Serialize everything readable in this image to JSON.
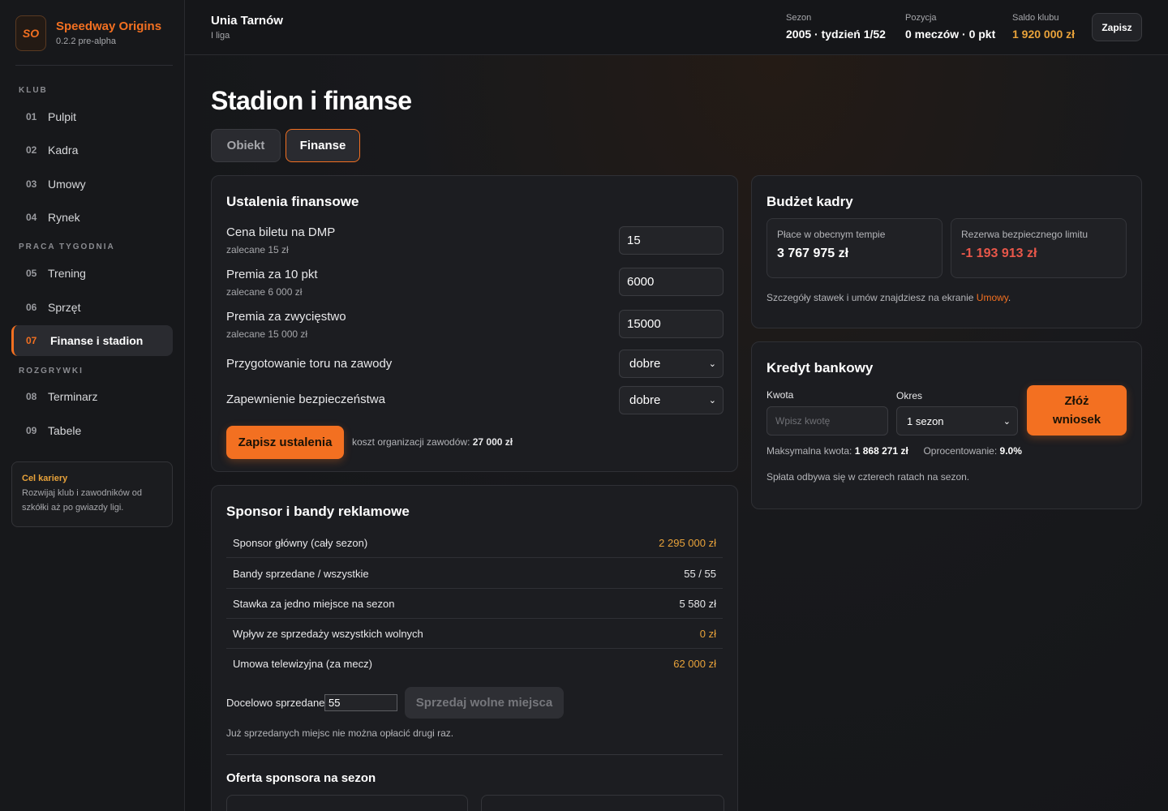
{
  "brand": {
    "logo": "SO",
    "name": "Speedway Origins",
    "version": "0.2.2 pre-alpha"
  },
  "nav": {
    "sections": [
      "KLUB",
      "PRACA TYGODNIA",
      "ROZGRYWKI"
    ],
    "items": [
      {
        "num": "01",
        "label": "Pulpit"
      },
      {
        "num": "02",
        "label": "Kadra"
      },
      {
        "num": "03",
        "label": "Umowy"
      },
      {
        "num": "04",
        "label": "Rynek"
      },
      {
        "num": "05",
        "label": "Trening"
      },
      {
        "num": "06",
        "label": "Sprzęt"
      },
      {
        "num": "07",
        "label": "Finanse i stadion"
      },
      {
        "num": "08",
        "label": "Terminarz"
      },
      {
        "num": "09",
        "label": "Tabele"
      }
    ]
  },
  "career": {
    "title": "Cel kariery",
    "text": "Rozwijaj klub i zawodników od szkółki aż po gwiazdy ligi."
  },
  "top": {
    "team": "Unia Tarnów",
    "league": "I liga",
    "season_label": "Sezon",
    "season_value": "2005 · tydzień 1/52",
    "position_label": "Pozycja",
    "position_value": "0 meczów · 0 pkt",
    "balance_label": "Saldo klubu",
    "balance_value": "1 920 000 zł",
    "save": "Zapisz"
  },
  "page": {
    "title": "Stadion i finanse",
    "tabs": [
      "Obiekt",
      "Finanse"
    ]
  },
  "settings": {
    "title": "Ustalenia finansowe",
    "ticket_label": "Cena biletu na DMP",
    "ticket_hint": "zalecane 15 zł",
    "ticket_value": "15",
    "bonus10_label": "Premia za 10 pkt",
    "bonus10_hint": "zalecane 6 000 zł",
    "bonus10_value": "6000",
    "win_label": "Premia za zwycięstwo",
    "win_hint": "zalecane 15 000 zł",
    "win_value": "15000",
    "track_label": "Przygotowanie toru na zawody",
    "track_value": "dobre",
    "safety_label": "Zapewnienie bezpieczeństwa",
    "safety_value": "dobre",
    "save_btn": "Zapisz ustalenia",
    "cost_text": "koszt organizacji zawodów:",
    "cost_value": "27 000 zł"
  },
  "sponsor": {
    "title": "Sponsor i bandy reklamowe",
    "rows": [
      {
        "label": "Sponsor główny (cały sezon)",
        "value": "2 295 000 zł"
      },
      {
        "label": "Bandy sprzedane / wszystkie",
        "value": "55 / 55"
      },
      {
        "label": "Stawka za jedno miejsce na sezon",
        "value": "5 580 zł"
      },
      {
        "label": "Wpływ ze sprzedaży wszystkich wolnych",
        "value": "0 zł"
      },
      {
        "label": "Umowa telewizyjna (za mecz)",
        "value": "62 000 zł"
      }
    ],
    "target_label": "Docelowo sprzedane",
    "target_value": "55",
    "sell_btn": "Sprzedaj wolne miejsca",
    "note": "Już sprzedanych miejsc nie można opłacić drugi raz.",
    "offer_title": "Oferta sponsora na sezon"
  },
  "budget": {
    "title": "Budżet kadry",
    "wages_label": "Płace w obecnym tempie",
    "wages_value": "3 767 975 zł",
    "reserve_label": "Rezerwa bezpiecznego limitu",
    "reserve_value": "-1 193 913 zł",
    "note_prefix": "Szczegóły stawek i umów znajdziesz na ekranie",
    "note_link": "Umowy",
    "note_suffix": "."
  },
  "loan": {
    "title": "Kredyt bankowy",
    "amount_label": "Kwota",
    "amount_placeholder": "Wpisz kwotę",
    "period_label": "Okres",
    "period_value": "1 sezon",
    "apply_btn_l1": "Złóż",
    "apply_btn_l2": "wniosek",
    "max_label": "Maksymalna kwota:",
    "max_value": "1 868 271 zł",
    "rate_label": "Oprocentowanie:",
    "rate_value": "9.0%",
    "note": "Spłata odbywa się w czterech ratach na sezon."
  },
  "colors": {
    "accent": "#f37021",
    "gold": "#e8a23a",
    "negative": "#e8574a"
  }
}
